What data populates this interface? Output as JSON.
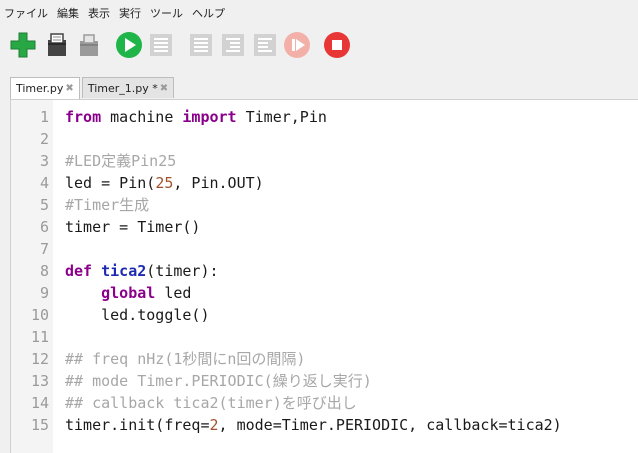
{
  "menu": [
    "ファイル",
    "編集",
    "表示",
    "実行",
    "ツール",
    "ヘルプ"
  ],
  "toolbar": [
    {
      "name": "new-file-icon",
      "color": "#27a844"
    },
    {
      "name": "open-file-icon",
      "color": "#333333"
    },
    {
      "name": "save-file-icon",
      "color": "#9a9a9a"
    },
    {
      "name": "run-icon",
      "color": "#1fb548"
    },
    {
      "name": "debug-icon",
      "color": "#cfcfcf"
    },
    {
      "name": "step-over-icon",
      "color": "#cfcfcf"
    },
    {
      "name": "step-into-icon",
      "color": "#cfcfcf"
    },
    {
      "name": "step-out-icon",
      "color": "#cfcfcf"
    },
    {
      "name": "resume-icon",
      "color": "#f2b0a8"
    },
    {
      "name": "stop-icon",
      "color": "#e83535"
    }
  ],
  "tabs": [
    {
      "label": "Timer.py",
      "close": "✖",
      "active": true
    },
    {
      "label": "Timer_1.py *",
      "close": "✖",
      "active": false
    }
  ],
  "code": [
    {
      "n": "1",
      "tokens": [
        [
          "kw",
          "from"
        ],
        [
          "default",
          " machine "
        ],
        [
          "kw",
          "import"
        ],
        [
          "default",
          " Timer,Pin"
        ]
      ]
    },
    {
      "n": "2",
      "tokens": []
    },
    {
      "n": "3",
      "tokens": [
        [
          "comment",
          "#LED定義Pin25"
        ]
      ]
    },
    {
      "n": "4",
      "tokens": [
        [
          "default",
          "led = Pin("
        ],
        [
          "num",
          "25"
        ],
        [
          "default",
          ", Pin.OUT)"
        ]
      ]
    },
    {
      "n": "5",
      "tokens": [
        [
          "comment",
          "#Timer生成"
        ]
      ]
    },
    {
      "n": "6",
      "tokens": [
        [
          "default",
          "timer = Timer()"
        ]
      ]
    },
    {
      "n": "7",
      "tokens": []
    },
    {
      "n": "8",
      "tokens": [
        [
          "kw",
          "def"
        ],
        [
          "default",
          " "
        ],
        [
          "fn",
          "tica2"
        ],
        [
          "default",
          "(timer):"
        ]
      ]
    },
    {
      "n": "9",
      "tokens": [
        [
          "default",
          "    "
        ],
        [
          "kw",
          "global"
        ],
        [
          "default",
          " led"
        ]
      ]
    },
    {
      "n": "10",
      "tokens": [
        [
          "default",
          "    led.toggle()"
        ]
      ]
    },
    {
      "n": "11",
      "tokens": []
    },
    {
      "n": "12",
      "tokens": [
        [
          "comment",
          "## freq nHz(1秒間にn回の間隔)"
        ]
      ]
    },
    {
      "n": "13",
      "tokens": [
        [
          "comment",
          "## mode Timer.PERIODIC(繰り返し実行)"
        ]
      ]
    },
    {
      "n": "14",
      "tokens": [
        [
          "comment",
          "## callback tica2(timer)を呼び出し"
        ]
      ]
    },
    {
      "n": "15",
      "tokens": [
        [
          "default",
          "timer.init(freq="
        ],
        [
          "num",
          "2"
        ],
        [
          "default",
          ", mode=Timer.PERIODIC, callback=tica2)"
        ]
      ]
    }
  ]
}
